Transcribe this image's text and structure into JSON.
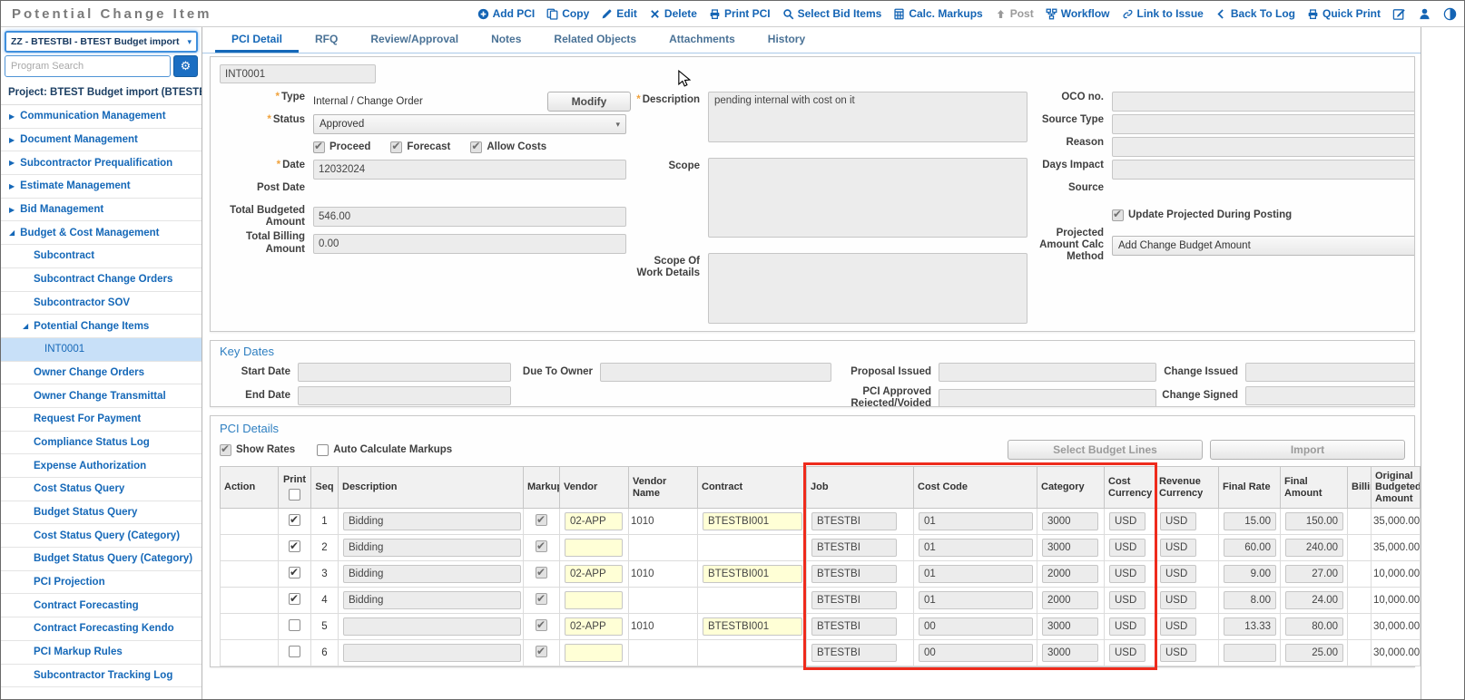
{
  "app": {
    "title": "Potential Change Item"
  },
  "colors": {
    "accent_blue": "#1464b4",
    "highlight_red": "#ee2b1c",
    "required_orange": "#f0a23c",
    "field_yellow": "#ffffd6"
  },
  "toolbar": {
    "items": [
      {
        "label": "Add PCI"
      },
      {
        "label": "Copy"
      },
      {
        "label": "Edit"
      },
      {
        "label": "Delete"
      },
      {
        "label": "Print PCI"
      },
      {
        "label": "Select Bid Items"
      },
      {
        "label": "Calc. Markups"
      },
      {
        "label": "Post",
        "disabled": true
      },
      {
        "label": "Workflow"
      },
      {
        "label": "Link to Issue"
      },
      {
        "label": "Back To Log"
      },
      {
        "label": "Quick Print"
      }
    ]
  },
  "sidebar": {
    "program_dropdown": {
      "value": "ZZ - BTESTBI - BTEST Budget import"
    },
    "search": {
      "placeholder": "Program Search"
    },
    "project_label": "Project: BTEST Budget import (BTESTBI)",
    "items": [
      {
        "label": "Communication Management",
        "level": 0,
        "expand": "collapsed"
      },
      {
        "label": "Document Management",
        "level": 0,
        "expand": "collapsed"
      },
      {
        "label": "Subcontractor Prequalification",
        "level": 0,
        "expand": "collapsed"
      },
      {
        "label": "Estimate Management",
        "level": 0,
        "expand": "collapsed"
      },
      {
        "label": "Bid Management",
        "level": 0,
        "expand": "collapsed"
      },
      {
        "label": "Budget & Cost Management",
        "level": 0,
        "expand": "expanded"
      },
      {
        "label": "Subcontract",
        "level": 1
      },
      {
        "label": "Subcontract Change Orders",
        "level": 1
      },
      {
        "label": "Subcontractor SOV",
        "level": 1
      },
      {
        "label": "Potential Change Items",
        "level": 1,
        "expand": "expanded"
      },
      {
        "label": "INT0001",
        "level": 2,
        "selected": true
      },
      {
        "label": "Owner Change Orders",
        "level": 1
      },
      {
        "label": "Owner Change Transmittal",
        "level": 1
      },
      {
        "label": "Request For Payment",
        "level": 1
      },
      {
        "label": "Compliance Status Log",
        "level": 1
      },
      {
        "label": "Expense Authorization",
        "level": 1
      },
      {
        "label": "Cost Status Query",
        "level": 1
      },
      {
        "label": "Budget Status Query",
        "level": 1
      },
      {
        "label": "Cost Status Query (Category)",
        "level": 1
      },
      {
        "label": "Budget Status Query (Category)",
        "level": 1
      },
      {
        "label": "PCI Projection",
        "level": 1
      },
      {
        "label": "Contract Forecasting",
        "level": 1
      },
      {
        "label": "Contract Forecasting Kendo",
        "level": 1
      },
      {
        "label": "PCI Markup Rules",
        "level": 1
      },
      {
        "label": "Subcontractor Tracking Log",
        "level": 1
      }
    ]
  },
  "tabs": [
    {
      "label": "PCI Detail",
      "active": true
    },
    {
      "label": "RFQ"
    },
    {
      "label": "Review/Approval"
    },
    {
      "label": "Notes"
    },
    {
      "label": "Related Objects"
    },
    {
      "label": "Attachments"
    },
    {
      "label": "History"
    }
  ],
  "detail": {
    "pci_code": "INT0001",
    "type_label": "Type",
    "type_value": "Internal / Change Order",
    "modify_button": "Modify",
    "status_label": "Status",
    "status_value": "Approved",
    "checkboxes": {
      "proceed": "Proceed",
      "forecast": "Forecast",
      "allow_costs": "Allow Costs"
    },
    "date_label": "Date",
    "date_value": "12032024",
    "post_date_label": "Post Date",
    "total_budgeted_label": "Total Budgeted Amount",
    "total_budgeted_value": "546.00",
    "total_billing_label": "Total Billing Amount",
    "total_billing_value": "0.00",
    "description_label": "Description",
    "description_value": "pending internal with cost on it",
    "scope_label": "Scope",
    "sow_label": "Scope Of Work Details",
    "oco_label": "OCO no.",
    "source_type_label": "Source Type",
    "reason_label": "Reason",
    "days_impact_label": "Days Impact",
    "source_label": "Source",
    "update_projected_label": "Update Projected During Posting",
    "calc_method_label": "Projected Amount Calc Method",
    "calc_method_value": "Add Change Budget Amount"
  },
  "key_dates": {
    "title": "Key Dates",
    "start_date_label": "Start Date",
    "end_date_label": "End Date",
    "due_to_owner_label": "Due To Owner",
    "proposal_issued_label": "Proposal Issued",
    "pci_approved_label": "PCI Approved Rejected/Voided",
    "change_issued_label": "Change Issued",
    "change_signed_label": "Change Signed"
  },
  "pci_details": {
    "title": "PCI Details",
    "show_rates_label": "Show Rates",
    "auto_calc_label": "Auto Calculate Markups",
    "select_budget_lines_button": "Select Budget Lines",
    "import_button": "Import",
    "columns": [
      "Action",
      "Print",
      "Seq",
      "Description",
      "Markup",
      "Vendor",
      "Vendor Name",
      "Contract",
      "Job",
      "Cost Code",
      "Category",
      "Cost Currency",
      "Revenue Currency",
      "Final Rate",
      "Final Amount",
      "Billing",
      "Original Budgeted Amount"
    ],
    "rows": [
      {
        "print": true,
        "seq": "1",
        "description": "Bidding",
        "markup": true,
        "vendor": "02-APP",
        "vendor_name": "1010",
        "contract": "BTESTBI001",
        "job": "BTESTBI",
        "cost_code": "01",
        "category": "3000",
        "cost_currency": "USD",
        "revenue_currency": "USD",
        "final_rate": "15.00",
        "final_amount": "150.00",
        "billing": "",
        "original_budgeted_amount": "35,000.00"
      },
      {
        "print": true,
        "seq": "2",
        "description": "Bidding",
        "markup": true,
        "vendor": "",
        "vendor_name": "",
        "contract": "",
        "job": "BTESTBI",
        "cost_code": "01",
        "category": "3000",
        "cost_currency": "USD",
        "revenue_currency": "USD",
        "final_rate": "60.00",
        "final_amount": "240.00",
        "billing": "",
        "original_budgeted_amount": "35,000.00"
      },
      {
        "print": true,
        "seq": "3",
        "description": "Bidding",
        "markup": true,
        "vendor": "02-APP",
        "vendor_name": "1010",
        "contract": "BTESTBI001",
        "job": "BTESTBI",
        "cost_code": "01",
        "category": "2000",
        "cost_currency": "USD",
        "revenue_currency": "USD",
        "final_rate": "9.00",
        "final_amount": "27.00",
        "billing": "",
        "original_budgeted_amount": "10,000.00"
      },
      {
        "print": true,
        "seq": "4",
        "description": "Bidding",
        "markup": true,
        "vendor": "",
        "vendor_name": "",
        "contract": "",
        "job": "BTESTBI",
        "cost_code": "01",
        "category": "2000",
        "cost_currency": "USD",
        "revenue_currency": "USD",
        "final_rate": "8.00",
        "final_amount": "24.00",
        "billing": "",
        "original_budgeted_amount": "10,000.00"
      },
      {
        "print": false,
        "seq": "5",
        "description": "",
        "markup": true,
        "vendor": "02-APP",
        "vendor_name": "1010",
        "contract": "BTESTBI001",
        "job": "BTESTBI",
        "cost_code": "00",
        "category": "3000",
        "cost_currency": "USD",
        "revenue_currency": "USD",
        "final_rate": "13.33",
        "final_amount": "80.00",
        "billing": "",
        "original_budgeted_amount": "30,000.00"
      },
      {
        "print": false,
        "seq": "6",
        "description": "",
        "markup": true,
        "vendor": "",
        "vendor_name": "",
        "contract": "",
        "job": "BTESTBI",
        "cost_code": "00",
        "category": "3000",
        "cost_currency": "USD",
        "revenue_currency": "USD",
        "final_rate": "",
        "final_amount": "25.00",
        "billing": "",
        "original_budgeted_amount": "30,000.00"
      }
    ]
  }
}
